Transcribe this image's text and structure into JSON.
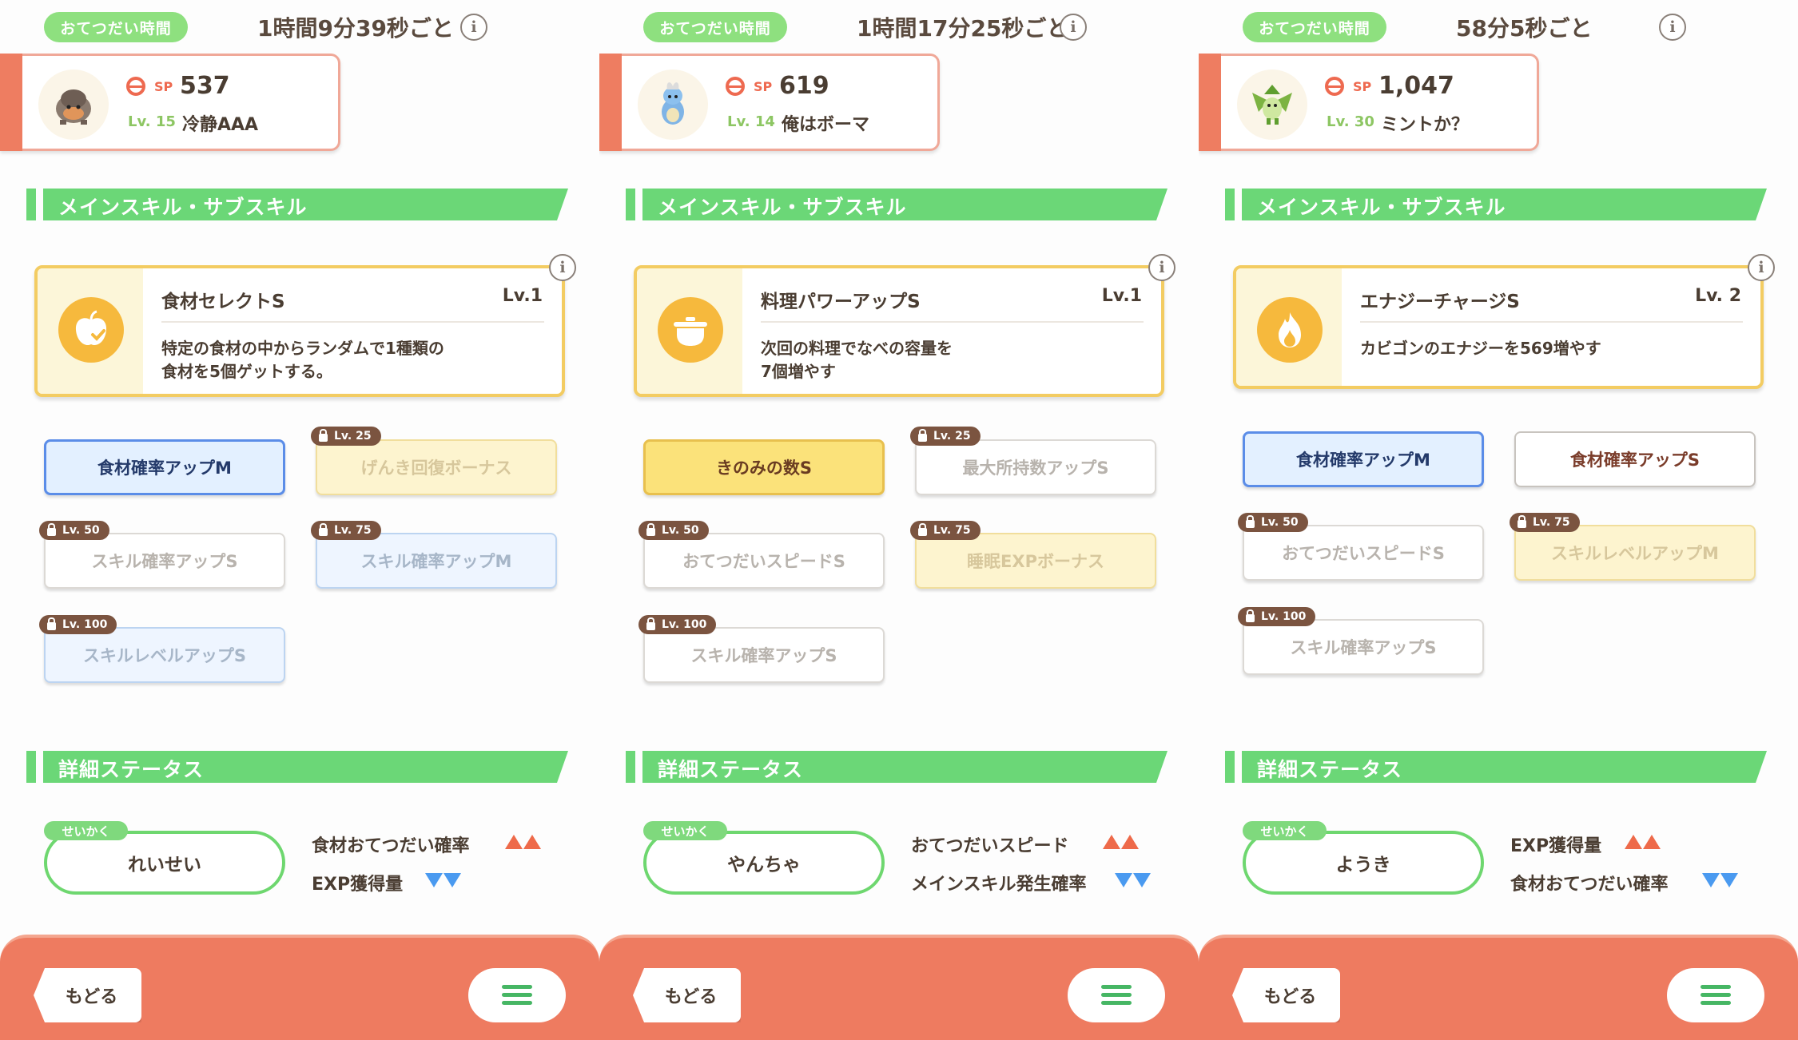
{
  "panels": [
    {
      "help": {
        "pill_label": "おてつだい時間",
        "time": "1時間9分39秒ごと"
      },
      "pokemon": {
        "sp_label": "SP",
        "sp": "537",
        "level": "Lv. 15",
        "name": "冷静AAA",
        "icon": "rock-pokemon-icon"
      },
      "skill_section": {
        "title": "メインスキル・サブスキル"
      },
      "main_skill": {
        "name": "食材セレクトS",
        "level": "Lv.1",
        "desc_line1": "特定の食材の中からランダムで1種類の",
        "desc_line2": "食材を5個ゲットする。",
        "icon": "apple-check-icon"
      },
      "sub_skills": [
        {
          "label": "食材確率アップM",
          "lock": ""
        },
        {
          "label": "げんき回復ボーナス",
          "lock": "Lv. 25"
        },
        {
          "label": "スキル確率アップS",
          "lock": "Lv. 50"
        },
        {
          "label": "スキル確率アップM",
          "lock": "Lv. 75"
        },
        {
          "label": "スキルレベルアップS",
          "lock": "Lv. 100"
        }
      ],
      "status_section": {
        "title": "詳細ステータス"
      },
      "nature": {
        "tag": "せいかく",
        "value": "れいせい",
        "up_stat": "食材おてつだい確率",
        "down_stat": "EXP獲得量"
      },
      "bottom": {
        "back_label": "もどる"
      }
    },
    {
      "help": {
        "pill_label": "おてつだい時間",
        "time": "1時間17分25秒ごと"
      },
      "pokemon": {
        "sp_label": "SP",
        "sp": "619",
        "level": "Lv. 14",
        "name": "俺はボーマ",
        "icon": "dragon-pokemon-icon"
      },
      "skill_section": {
        "title": "メインスキル・サブスキル"
      },
      "main_skill": {
        "name": "料理パワーアップS",
        "level": "Lv.1",
        "desc_line1": "次回の料理でなべの容量を",
        "desc_line2": "7個増やす",
        "icon": "pot-icon"
      },
      "sub_skills": [
        {
          "label": "きのみの数S",
          "lock": ""
        },
        {
          "label": "最大所持数アップS",
          "lock": "Lv. 25"
        },
        {
          "label": "おてつだいスピードS",
          "lock": "Lv. 50"
        },
        {
          "label": "睡眠EXPボーナス",
          "lock": "Lv. 75"
        },
        {
          "label": "スキル確率アップS",
          "lock": "Lv. 100"
        }
      ],
      "status_section": {
        "title": "詳細ステータス"
      },
      "nature": {
        "tag": "せいかく",
        "value": "やんちゃ",
        "up_stat": "おてつだいスピード",
        "down_stat": "メインスキル発生確率"
      },
      "bottom": {
        "back_label": "もどる"
      }
    },
    {
      "help": {
        "pill_label": "おてつだい時間",
        "time": "58分5秒ごと"
      },
      "pokemon": {
        "sp_label": "SP",
        "sp": "1,047",
        "level": "Lv. 30",
        "name": "ミントか？",
        "icon": "leaf-pokemon-icon"
      },
      "skill_section": {
        "title": "メインスキル・サブスキル"
      },
      "main_skill": {
        "name": "エナジーチャージS",
        "level": "Lv. 2",
        "desc_line1": "カビゴンのエナジーを569増やす",
        "desc_line2": "",
        "icon": "flame-icon"
      },
      "sub_skills": [
        {
          "label": "食材確率アップM",
          "lock": ""
        },
        {
          "label": "食材確率アップS",
          "lock": ""
        },
        {
          "label": "おてつだいスピードS",
          "lock": "Lv. 50"
        },
        {
          "label": "スキルレベルアップM",
          "lock": "Lv. 75"
        },
        {
          "label": "スキル確率アップS",
          "lock": "Lv. 100"
        }
      ],
      "status_section": {
        "title": "詳細ステータス"
      },
      "nature": {
        "tag": "せいかく",
        "value": "ようき",
        "up_stat": "EXP獲得量",
        "down_stat": "食材おてつだい確率"
      },
      "bottom": {
        "back_label": "もどる"
      }
    }
  ],
  "colors": {
    "accent_green": "#6bd777",
    "bottom_bar": "#ee7b60",
    "skill_border": "#f3cc62",
    "stat_up": "#ee6a4a",
    "stat_down": "#4a9af0"
  }
}
